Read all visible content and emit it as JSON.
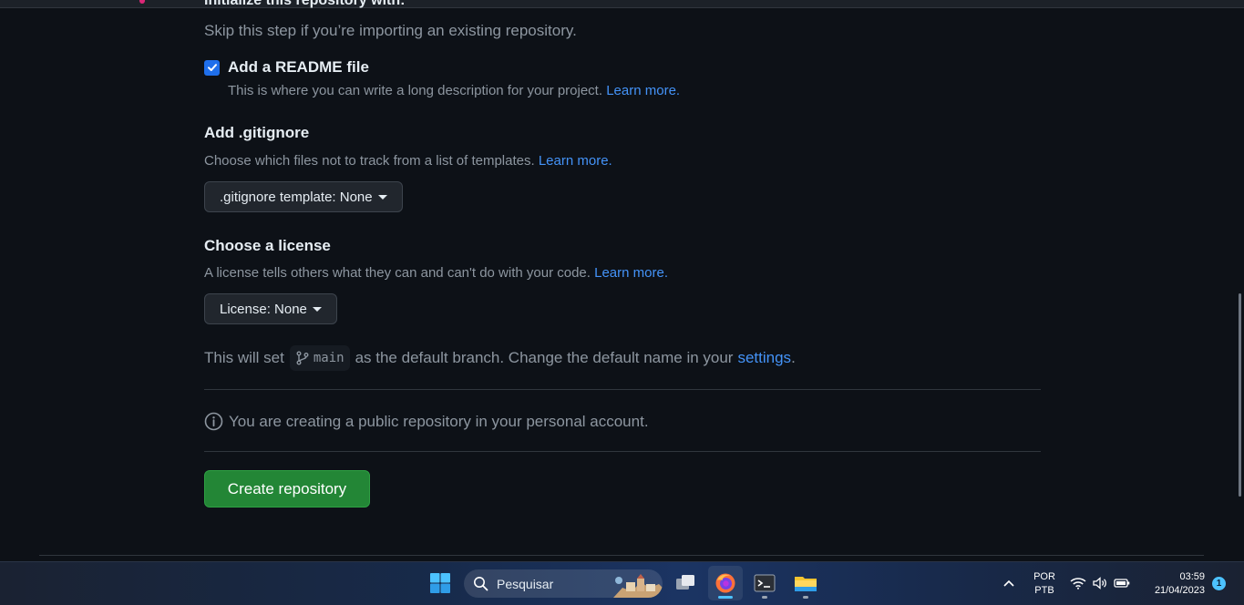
{
  "colors": {
    "background": "#0d1117",
    "link": "#4493f8",
    "primary_button": "#238636",
    "muted_text": "#8d96a0",
    "checkbox": "#1f6feb"
  },
  "init": {
    "heading": "Initialize this repository with:",
    "skip_text": "Skip this step if you’re importing an existing repository."
  },
  "readme": {
    "checked": true,
    "label": "Add a README file",
    "description": "This is where you can write a long description for your project.",
    "learn_more": "Learn more."
  },
  "gitignore": {
    "title": "Add .gitignore",
    "description": "Choose which files not to track from a list of templates.",
    "learn_more": "Learn more.",
    "select_label": ".gitignore template: None"
  },
  "license": {
    "title": "Choose a license",
    "description": "A license tells others what they can and can't do with your code.",
    "learn_more": "Learn more.",
    "select_label": "License: None"
  },
  "branch": {
    "prefix": "This will set",
    "branch_name": "main",
    "middle": "as the default branch. Change the default name in your",
    "settings_link": "settings",
    "suffix": "."
  },
  "notice": {
    "text": "You are creating a public repository in your personal account.",
    "icon": "info-icon"
  },
  "create_button": {
    "label": "Create repository"
  },
  "taskbar": {
    "search_placeholder": "Pesquisar",
    "language_line1": "POR",
    "language_line2": "PTB",
    "time": "03:59",
    "date": "21/04/2023",
    "notification_count": "1",
    "apps": [
      "start-icon",
      "search-icon",
      "task-view-icon",
      "firefox-icon",
      "terminal-icon",
      "file-explorer-icon"
    ],
    "tray": [
      "chevron-up-icon",
      "wifi-icon",
      "volume-icon",
      "battery-icon"
    ]
  }
}
